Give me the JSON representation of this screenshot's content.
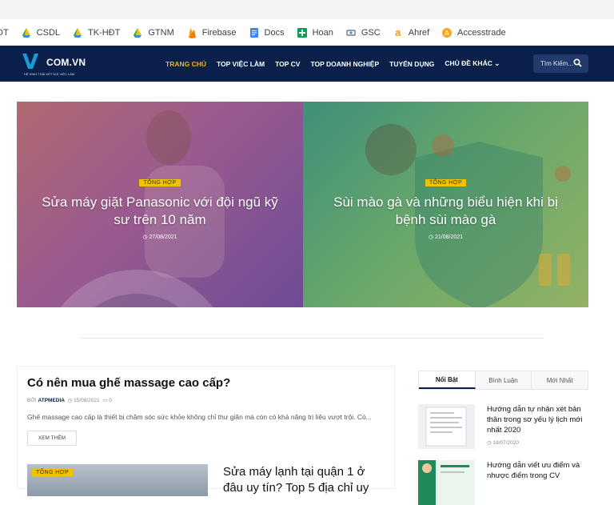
{
  "bookmarks": [
    {
      "label": "DT",
      "icon": "page-icon"
    },
    {
      "label": "CSDL",
      "icon": "google-drive-icon"
    },
    {
      "label": "TK-HĐT",
      "icon": "google-drive-icon"
    },
    {
      "label": "GTNM",
      "icon": "google-drive-icon"
    },
    {
      "label": "Firebase",
      "icon": "firebase-icon"
    },
    {
      "label": "Docs",
      "icon": "google-docs-icon"
    },
    {
      "label": "Hoan",
      "icon": "google-sheets-icon"
    },
    {
      "label": "GSC",
      "icon": "search-console-icon"
    },
    {
      "label": "Ahref",
      "icon": "amazon-icon"
    },
    {
      "label": "Accesstrade",
      "icon": "accesstrade-icon"
    }
  ],
  "site": {
    "logo_mark": "V",
    "logo_text": "COM.VN",
    "logo_tagline": "HỆ SINH THÁI KẾT NỐI VIỆC LÀM"
  },
  "nav": {
    "items": [
      "TRANG CHỦ",
      "TOP VIỆC LÀM",
      "TOP CV",
      "TOP DOANH NGHIỆP",
      "TUYỂN DỤNG",
      "CHỦ ĐỀ KHÁC ⌄"
    ],
    "search_label": "Tìm Kiếm..."
  },
  "hero": [
    {
      "badge": "TỔNG HỢP",
      "title": "Sửa máy giặt Panasonic với đội ngũ kỹ sư trên 10 năm",
      "date": "27/08/2021"
    },
    {
      "badge": "TỔNG HỢP",
      "title": "Sùi mào gà và những biểu hiện khi bị bệnh sùi mào gà",
      "date": "21/08/2021"
    }
  ],
  "article": {
    "title": "Có nên mua ghế massage cao cấp?",
    "by_label": "BỞI",
    "author": "ATPMEDIA",
    "date": "15/08/2021",
    "comments": "0",
    "excerpt": "Ghế massage cao cấp là thiết bị chăm sóc sức khỏe không chỉ thư giãn mà còn có khả năng trị liệu vượt trội. Có...",
    "read_more": "XEM THÊM"
  },
  "article2": {
    "badge": "TỔNG HỢP",
    "title": "Sửa máy lạnh tại quận 1 ở đâu uy tín? Top 5 địa chỉ uy"
  },
  "sidebar": {
    "tabs": [
      "Nổi Bật",
      "Bình Luận",
      "Mới Nhất"
    ],
    "posts": [
      {
        "title": "Hướng dẫn tự nhận xét bản thân trong sơ yếu lý lịch mới nhất 2020",
        "date": "18/07/2020"
      },
      {
        "title": "Hướng dẫn viết ưu điểm và nhược điểm trong CV",
        "date": ""
      }
    ]
  },
  "colors": {
    "nav_bg": "#0b1f4b",
    "accent": "#f2b31c",
    "badge": "#f2c100"
  }
}
